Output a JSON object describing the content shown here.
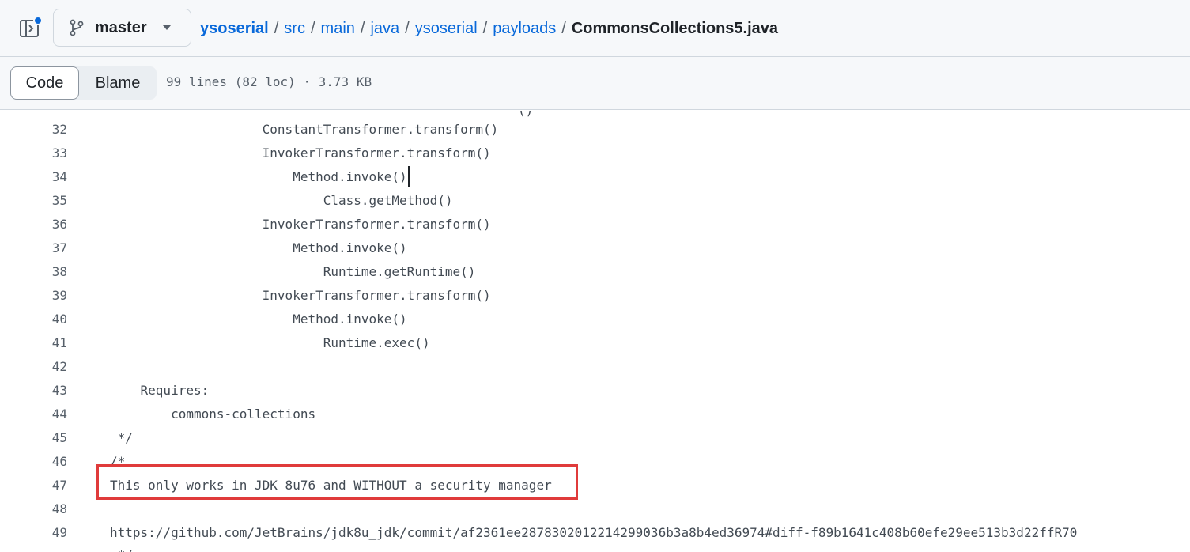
{
  "header": {
    "branch": "master",
    "breadcrumb": {
      "repo": "ysoserial",
      "parts": [
        "src",
        "main",
        "java",
        "ysoserial",
        "payloads"
      ],
      "current": "CommonsCollections5.java",
      "separator": "/"
    }
  },
  "toolbar": {
    "tabs": [
      {
        "label": "Code",
        "active": true
      },
      {
        "label": "Blame",
        "active": false
      }
    ],
    "file_meta": "99 lines (82 loc) · 3.73 KB"
  },
  "code": {
    "partial_top": "()",
    "lines": [
      {
        "num": "32",
        "text": "                    ConstantTransformer.transform()"
      },
      {
        "num": "33",
        "text": "                    InvokerTransformer.transform()"
      },
      {
        "num": "34",
        "text": "                        Method.invoke()",
        "cursor": true
      },
      {
        "num": "35",
        "text": "                            Class.getMethod()"
      },
      {
        "num": "36",
        "text": "                    InvokerTransformer.transform()"
      },
      {
        "num": "37",
        "text": "                        Method.invoke()"
      },
      {
        "num": "38",
        "text": "                            Runtime.getRuntime()"
      },
      {
        "num": "39",
        "text": "                    InvokerTransformer.transform()"
      },
      {
        "num": "40",
        "text": "                        Method.invoke()"
      },
      {
        "num": "41",
        "text": "                            Runtime.exec()"
      },
      {
        "num": "42",
        "text": ""
      },
      {
        "num": "43",
        "text": "    Requires:"
      },
      {
        "num": "44",
        "text": "        commons-collections"
      },
      {
        "num": "45",
        "text": " */"
      },
      {
        "num": "46",
        "text": "/*"
      },
      {
        "num": "47",
        "text": "This only works in JDK 8u76 and WITHOUT a security manager",
        "highlighted": true
      },
      {
        "num": "48",
        "text": ""
      },
      {
        "num": "49",
        "text": "https://github.com/JetBrains/jdk8u_jdk/commit/af2361ee2878302012214299036b3a8b4ed36974#diff-f89b1641c408b60efe29ee513b3d22ffR70"
      }
    ],
    "partial_bottom": " */"
  },
  "colors": {
    "link": "#0969da",
    "highlight_border": "#e03b3b",
    "header_bg": "#f6f8fa"
  }
}
